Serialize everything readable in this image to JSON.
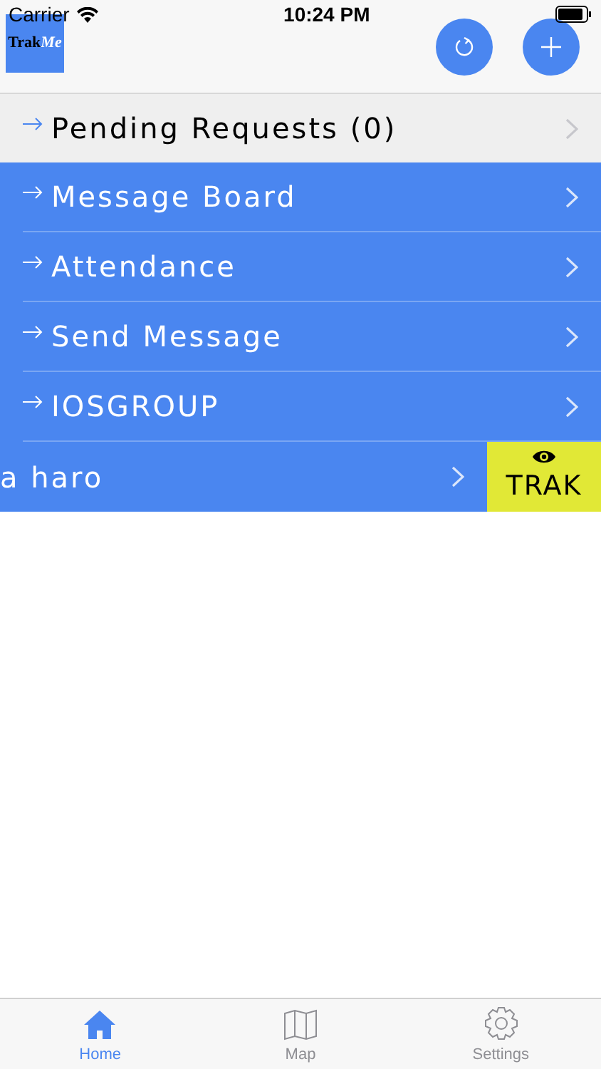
{
  "status_bar": {
    "carrier": "Carrier",
    "time": "10:24 PM"
  },
  "logo": {
    "part_1": "Trak",
    "part_2": "Me"
  },
  "list": [
    {
      "kind": "pending",
      "label": "Pending Requests (0)"
    },
    {
      "kind": "group",
      "label": "Message Board"
    },
    {
      "kind": "group",
      "label": "Attendance"
    },
    {
      "kind": "group",
      "label": "Send Message"
    },
    {
      "kind": "group",
      "label": "IOSGROUP"
    },
    {
      "kind": "swiped",
      "label": "a haro",
      "action": "TRAK"
    }
  ],
  "tabs": [
    {
      "label": "Home",
      "selected": true
    },
    {
      "label": "Map",
      "selected": false
    },
    {
      "label": "Settings",
      "selected": false
    }
  ]
}
